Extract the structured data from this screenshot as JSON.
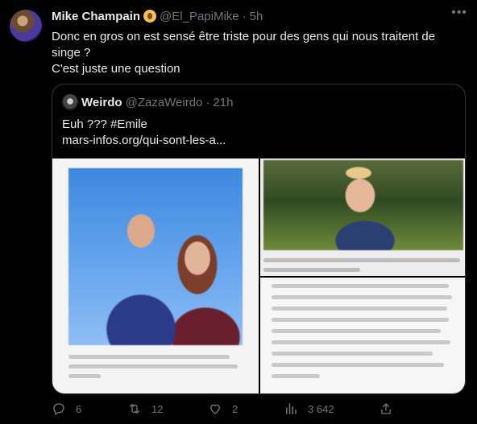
{
  "tweet": {
    "author_name": "Mike Champain",
    "author_handle": "@El_PapiMike",
    "separator": "·",
    "time": "5h",
    "more_glyph": "•••",
    "text_line1": "Donc en gros on est sensé être triste pour des gens qui nous traitent de singe ?",
    "text_line2": "C'est juste une question"
  },
  "quote": {
    "author_name": "Weirdo",
    "author_handle": "@ZazaWeirdo",
    "separator": "·",
    "time": "21h",
    "text_line1": "Euh ??? #Emile",
    "text_line2": "mars-infos.org/qui-sont-les-a..."
  },
  "actions": {
    "replies": "6",
    "retweets": "12",
    "likes": "2",
    "views": "3 642"
  },
  "icons": {
    "reply": "reply-icon",
    "retweet": "retweet-icon",
    "like": "heart-icon",
    "views": "views-icon",
    "share": "share-icon"
  }
}
